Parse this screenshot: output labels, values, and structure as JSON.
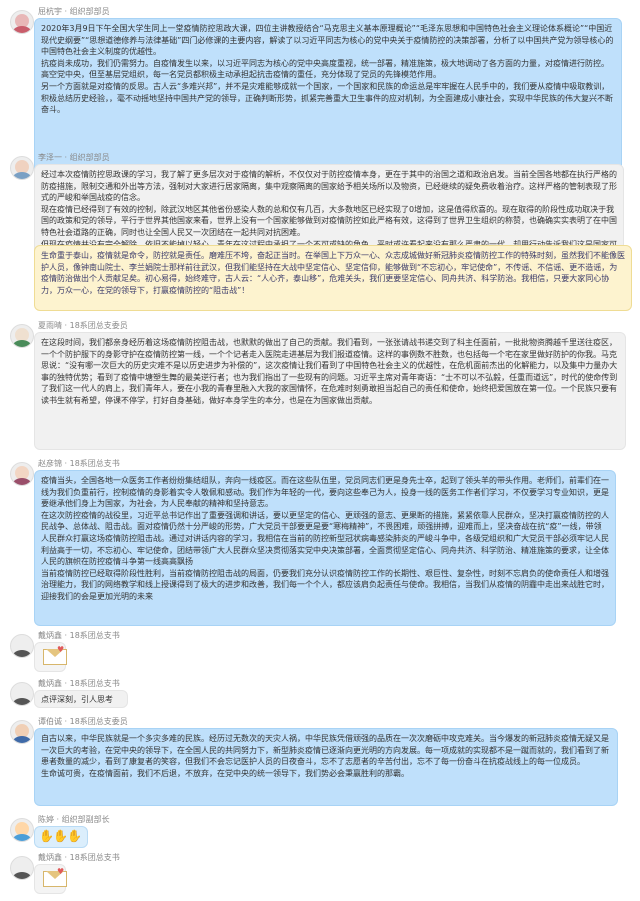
{
  "messages": [
    {
      "sender": "屈杭宇 · 组织部部员",
      "style": "blue",
      "paragraphs": [
        "2020年3月9日下午全国大学生同上一堂疫情防控思政大课，四位主讲教授结合“马克思主义基本原理概论”“毛泽东思想和中国特色社会主义理论体系概论”“中国近现代史纲要”“思想道德修养与法律基础”四门必修课的主要内容，解读了以习近平同志为核心的党中央关于疫情防控的决策部署，分析了以中国共产党为领导核心的中国特色社会主义制度的优越性。",
        "抗疫尚未成功，我们仍需努力。自疫情发生以来，以习近平同志为核心的党中央高度重视，统一部署，精准施策，极大地调动了各方面的力量，对疫情进行防控。高空党中央，但至基层党组织，每一名党员都积极主动承担起抗击疫情的重任，充分体现了党员的先锋模范作用。",
        "另一个方面就是对疫情的反思。古人云“多难兴邦”，并不是灾难能够成就一个国家，一个国家和民族的命运总是牢牢握在人民手中的，我们要从疫情中吸取教训，积极总结历史经验，，毫不动摇地坚持中国共产党的领导，正确判断形势，抓紧完善重大卫生事件的应对机制，为全面建成小康社会，实现中华民族的伟大复兴不断奋斗。"
      ]
    },
    {
      "sender": "李泽一 · 组织部部员",
      "style": "gray",
      "paragraphs": [
        "经过本次疫情防控思政课的学习，我了解了更多层次对于疫情的解析，不仅仅对于防控疫情本身，更在于其中的治国之道和政治启发。当前全国各地都在执行严格的防疫措施，限制交通和外出等方法，强制对大家进行居家隔离，集中观察隔离的国家给予相关场所以及物资，已经继续的疑免费收着治疗。这样严格的管制表现了形式的严峻和举国战疫的信念。",
        "现在疫情已经得到了有效的控制，除武汉地区其他省份感染人数的总和仅有几百，大多数地区已经实现了0增加，这是值得欣喜的。现在取得的阶段性成功取决于我国的政策和党的领导，平行于世界其他国家来看，世界上没有一个国家能够做到对疫情防控如此严格有效，这得到了世界卫生组织的称赞，也确确实实表明了在中国特色社会道路的正确，同时也让全国人民又一次团结在一起共同对抗困难。",
        "但现在疫情并没有完全解除，依旧不能掉以轻心，青年在这过程中承担了一个不可或缺的角色，平时或许看起来没有那么严肃的一代，却用行动告诉我们这是国家可以放心的一代，面对疫情大家在为党的领导和政府地位上的信心充分，"
      ]
    },
    {
      "sender": "",
      "style": "yellow",
      "paragraphs": [
        "生命重于泰山，疫情就是命令，防控就是责任。磨难压不垮，奋起正当时。在举国上下万众一心、众志成城做好新冠肺炎疫情防控工作的特殊时刻，虽然我们不能像医护人员，像钟南山院士、李兰娟院士那样前往武汉，但我们能坚持在大战中坚定信心、坚定信仰，能够做到“不忘初心，牢记使命”，不传谣、不信谣、更不造谣，为疫情防治做出个人贡献足矣。初心易得，始终难守，古人云：“人心齐，泰山移”，危难关头，我们更要坚定信心、同舟共济、科学防治。我相信，只要大家同心协力，万众一心，在党的领导下，打赢疫情防控的“阻击战”！"
      ]
    },
    {
      "sender": "夏雨晴 · 18系团总支委员",
      "style": "gray",
      "paragraphs": [
        "在这段时间，我们都亲身经历着这场疫情防控阻击战，也默默的做出了自己的贡献。我们看到，一张张请战书递交到了科主任面前，一批批物资腾越千里送往疫区，一个个防护服下的身影守护在疫情防控第一线，一个个记者走入医院走进基层为我们报道疫情。这样的事例数不胜数，也包括每一个宅在家里做好防护的你我。马克思说：“没有哪一次巨大的历史灾难不是以历史进步为补偿的”，这次疫情让我们看到了中国特色社会主义的优越性，在危机面前杰出的化解能力，以及集中力量办大事的独特优势；看到了疫情中塘塑生舞的最美逆行者；也为我们指出了一些现有的问题。习近平主席对青年寄语：“士不可以不弘毅，任重而道远”，时代的使命传到了我们这一代人的肩上，我们青年人，要在小我的青春里融入大我的家国情怀，在危难时刻勇敢担当起自己的责任和使命，始终把爱国放在第一位。一个民族只要有读书生就有希望，停课不停学，打好自身基础，做好本身学生的本分，也是在为国家做出贡献。"
      ]
    },
    {
      "sender": "赵彦锦 · 18系团总支书",
      "style": "blue",
      "paragraphs": [
        "疫情当头，全国各地一众医务工作者纷纷集结组队，奔向一线疫区。而在这些队伍里，党员同志们更是身先士卒，起到了领头羊的带头作用。老师们，前辈们在一线为我们负重前行，控制疫情的身影着实令人敬佩和感动。我们作为年轻的一代，要向这些奉己为人，投身一线的医务工作者们学习，不仅要学习专业知识，更是要继承他们身上为国家，为社会，为人民奉献的精神和坚持意志。",
        "在这次防控疫情的战役里，习近平总书记作出了重要强调和讲话，要以更坚定的信心、更顽强的意志、更果断的措施，紧紧依靠人民群众，坚决打赢疫情防控的人民战争、总体战、阻击战。面对疫情仍然十分严峻的形势，广大党员干部要更是要“寒梅精神”，不畏困难，顽强拼搏，迎难而上，坚决奋战在抗“疫”一线，带领人民群众打赢这场疫情防控阻击战。通过对讲话内容的学习，我相信在当前的防控新型冠状病毒感染肺炎的严峻斗争中，各级党组织和广大党员干部必须牢记人民利益高于一切，不忘初心、牢记使命，团结带领广大人民群众坚决贯彻落实党中央决策部署，全面贯彻坚定信心、同舟共济、科学防治、精准施策的要求，让全体人民的旗帜在防控疫情斗争第一线高高飘扬",
        "当前疫情防控已经取得阶段性胜利，当前疫情防控阻击战的局面，仍要我们充分认识疫情防控工作的长期性、艰巨性、复杂性，时刻不忘肩负的使命责任人和增强治理能力，我们的网络教学和线上授课得到了极大的进步和改善，我们每一个个人，都应该肩负起责任与使命。我相信，当我们从疫情的阴霾中走出来战胜它时，迎接我们的会是更加光明的未来"
      ]
    },
    {
      "sender": "戴炳鑫 · 18系团总支书",
      "style": "sticker"
    },
    {
      "sender": "戴炳鑫 · 18系团总支书",
      "style": "gray",
      "paragraphs": [
        "点评深刻，引人思考"
      ]
    },
    {
      "sender": "谭伯诚 · 18系团总支委员",
      "style": "blue",
      "paragraphs": [
        "自古以来，中华民族就是一个多灾多难的民族。经历过无数次的天灾人祸，中华民族凭借顽强的品质在一次次磨砺中攻克难关。当今爆发的新冠肺炎疫情无疑又是一次巨大的考验，在党中央的领导下，在全国人民的共同努力下，新型肺炎疫情已逐渐向更光明的方向发展。每一项成就的实现都不是一蹴而就的，我们看到了新患者数量的减少，看到了康复者的笑容，但我们不会忘记医护人员的日夜奋斗，忘不了志愿者的辛苦付出，忘不了每一份奋斗在抗疫战线上的每一位成员。",
        "生命诚可贵，在疫情面前，我们不后退，不放弃，在党中央的统一领导下，我们势必会秉赢胜利的那霸。"
      ]
    },
    {
      "sender": "陈婷 · 组织部副部长",
      "style": "clap"
    },
    {
      "sender": "戴炳鑫 · 18系团总支书",
      "style": "sticker"
    }
  ],
  "colors": {
    "blue_bubble": "#bfe0fb",
    "gray_bubble": "#f1f1f1",
    "yellow_bubble": "#fdf3cf"
  }
}
